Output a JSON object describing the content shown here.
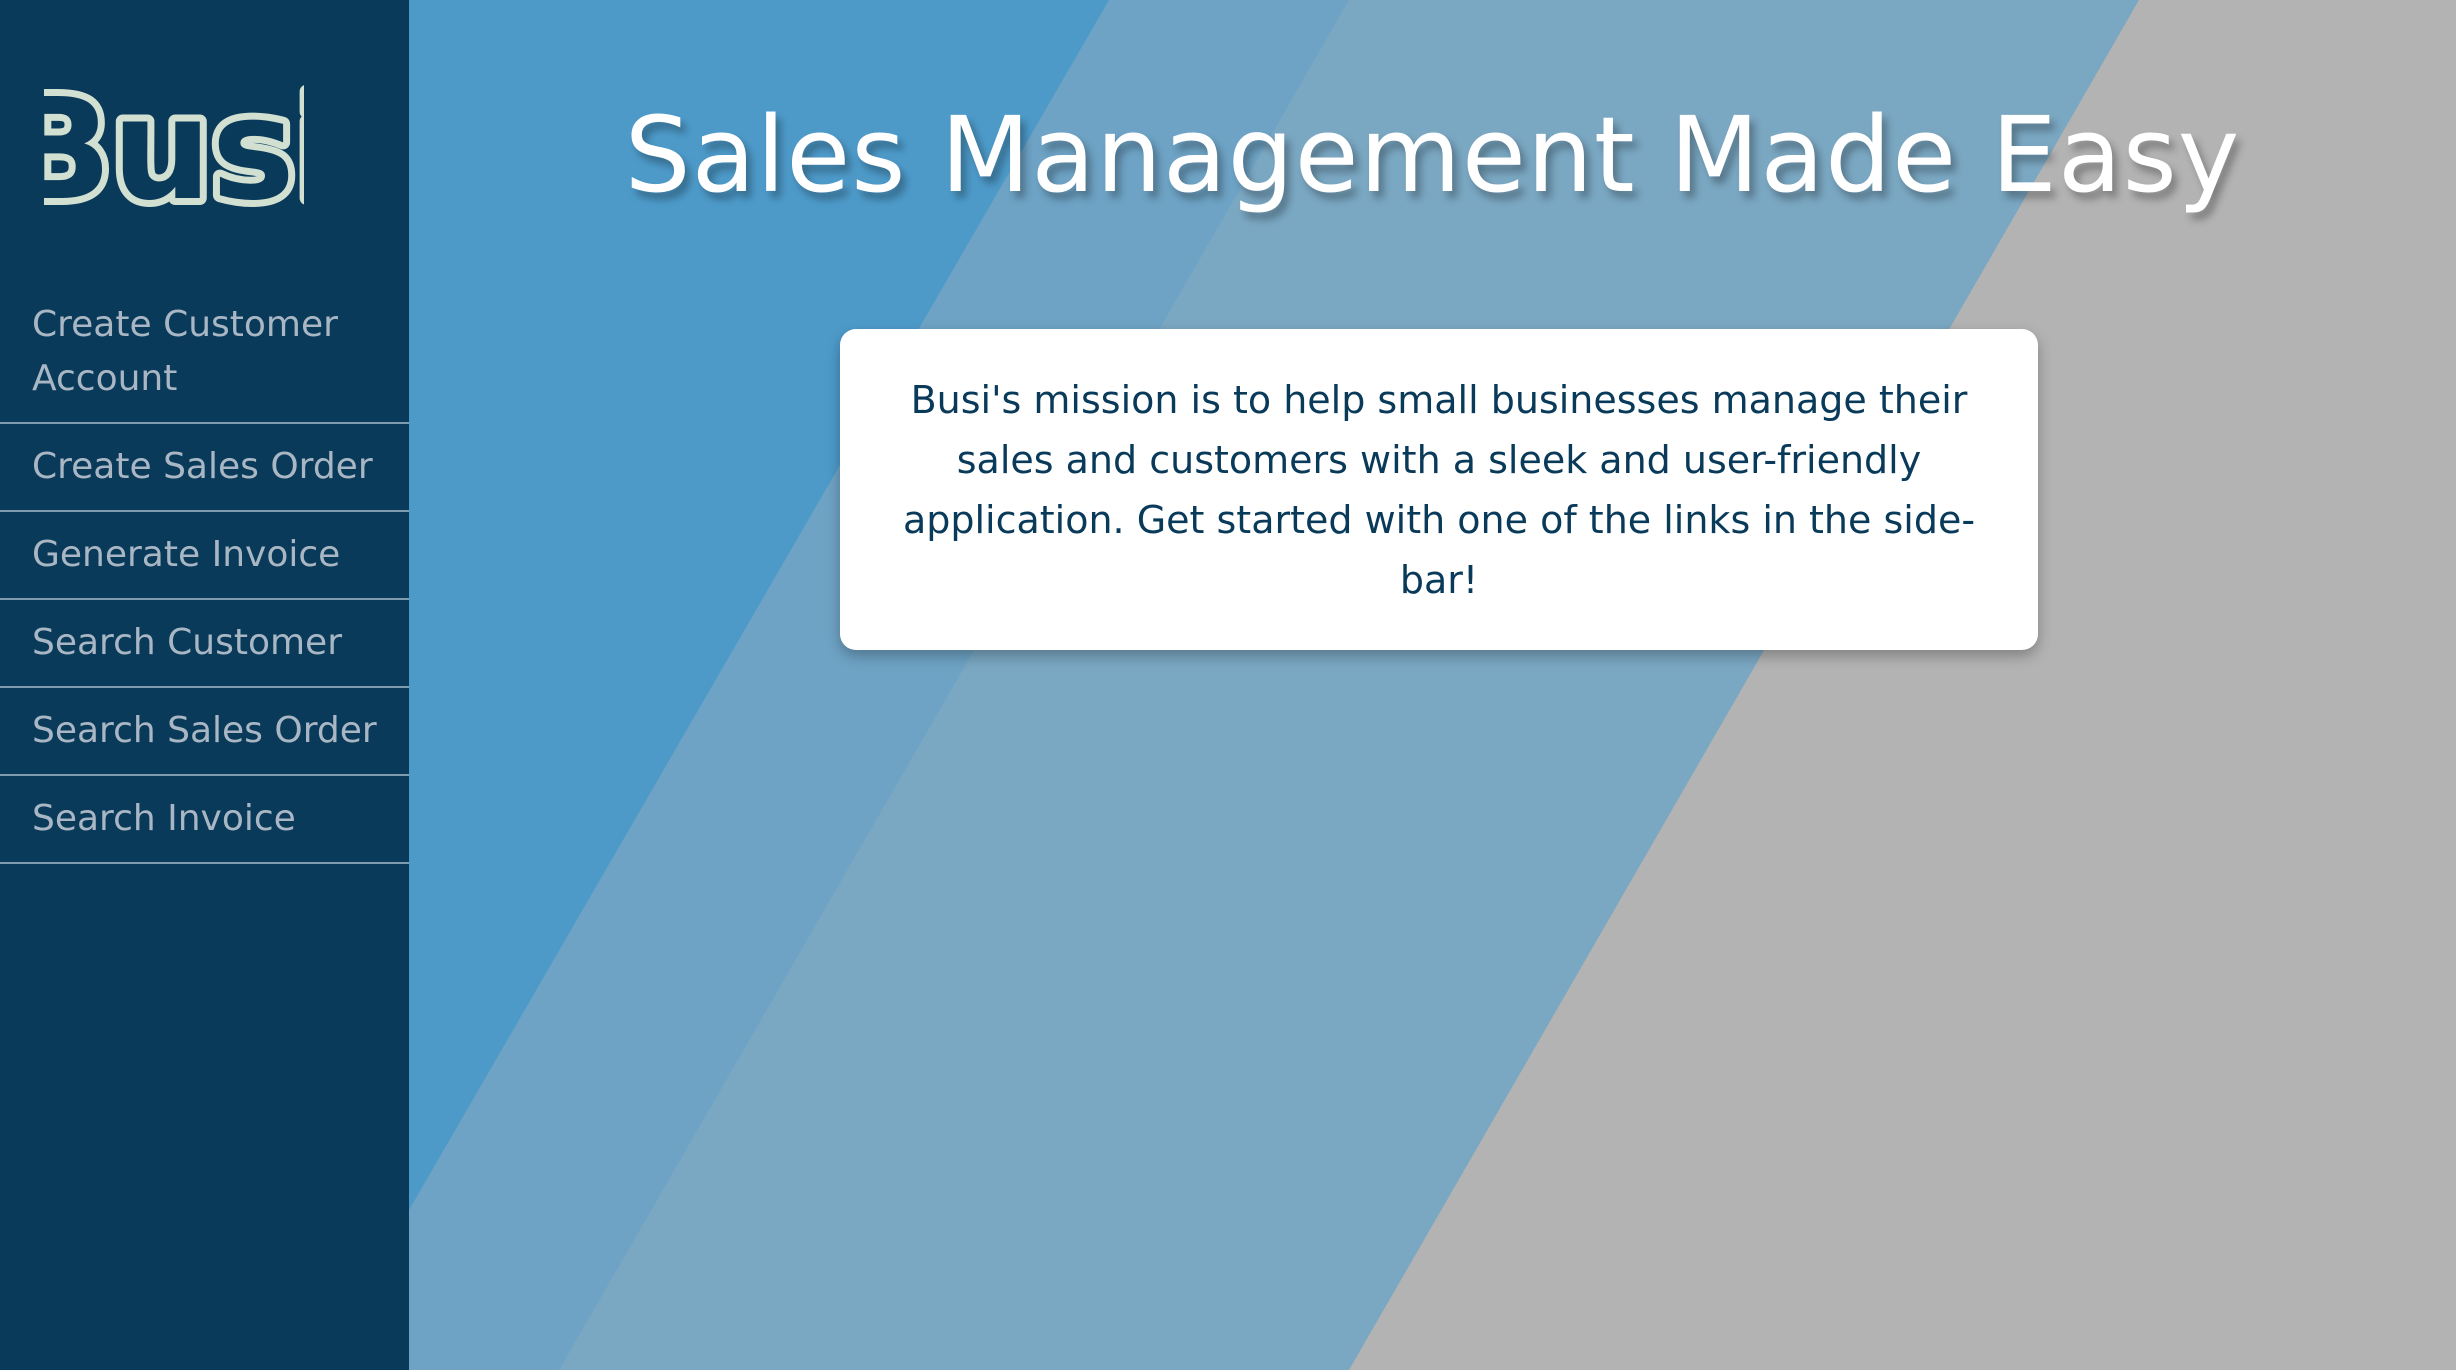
{
  "colors": {
    "sidebar_bg": "#0a3a5a",
    "nav_text": "#a9b7c4",
    "nav_divider": "#7f9bb0",
    "logo_fill": "#0a3a5a",
    "logo_stroke": "#d2e0d2",
    "stripe_1": "#4d9ac9",
    "stripe_2": "#6ea3c5",
    "stripe_3": "#7aa7c2",
    "page_bg": "#b3b3b3",
    "title_text": "#ffffff",
    "card_bg": "#ffffff",
    "card_text": "#0a3a5a"
  },
  "sidebar": {
    "logo_text": "Busi",
    "items": [
      {
        "label": "Create Customer Account"
      },
      {
        "label": "Create Sales Order"
      },
      {
        "label": "Generate Invoice"
      },
      {
        "label": "Search Customer"
      },
      {
        "label": "Search Sales Order"
      },
      {
        "label": "Search Invoice"
      }
    ]
  },
  "main": {
    "title": "Sales Management Made Easy",
    "mission": "Busi's mission is to help small businesses manage their sales and customers with a sleek and user-friendly application. Get started with one of the links in the side-bar!"
  }
}
